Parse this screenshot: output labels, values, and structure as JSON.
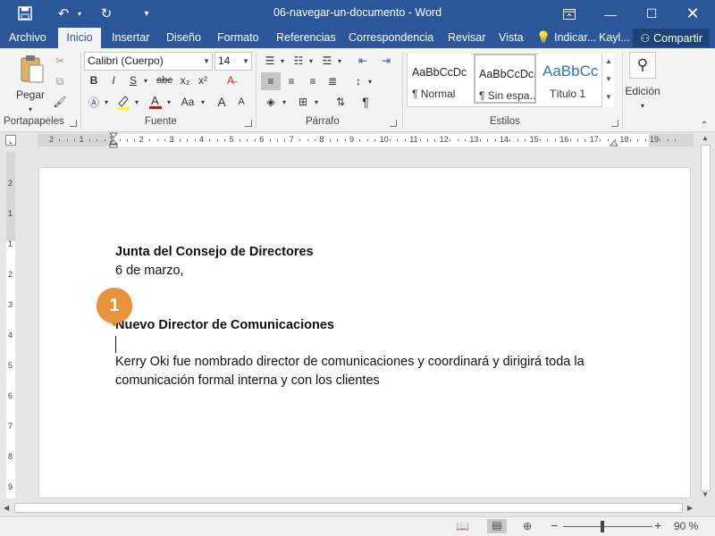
{
  "window": {
    "title": "06-navegar-un-documento  -  Word"
  },
  "quick_access": {
    "icons": [
      "save-icon",
      "undo-icon",
      "redo-icon",
      "customize-icon"
    ]
  },
  "menu": {
    "tabs": [
      {
        "label": "Archivo",
        "active": false
      },
      {
        "label": "Inicio",
        "active": true
      },
      {
        "label": "Insertar",
        "active": false
      },
      {
        "label": "Diseño",
        "active": false
      },
      {
        "label": "Formato",
        "active": false
      },
      {
        "label": "Referencias",
        "active": false
      },
      {
        "label": "Correspondencia",
        "active": false
      },
      {
        "label": "Revisar",
        "active": false
      },
      {
        "label": "Vista",
        "active": false
      }
    ],
    "tell_me": "Indicar...",
    "user": "Kayl...",
    "share_label": "Compartir"
  },
  "ribbon": {
    "clipboard": {
      "paste_label": "Pegar",
      "group_label": "Portapapeles"
    },
    "font": {
      "font_name": "Calibri (Cuerpo)",
      "font_size": "14",
      "group_label": "Fuente",
      "bold": "B",
      "italic": "I",
      "underline": "S",
      "strike": "abc",
      "sub": "x₂",
      "sup": "x²",
      "grow": "A",
      "shrink": "A",
      "case": "Aa"
    },
    "paragraph": {
      "group_label": "Párrafo",
      "pilcrow": "¶"
    },
    "styles": {
      "group_label": "Estilos",
      "tiles": [
        {
          "sample": "AaBbCcDc",
          "name": "¶ Normal"
        },
        {
          "sample": "AaBbCcDc",
          "name": "¶ Sin espa..."
        },
        {
          "sample": "AaBbCc",
          "name": "Título 1"
        }
      ]
    },
    "editing": {
      "label": "Edición"
    }
  },
  "ruler": {
    "numbers": [
      "2",
      "1",
      "1",
      "2",
      "3",
      "4",
      "5",
      "6",
      "7",
      "8",
      "9",
      "10",
      "11",
      "12",
      "13",
      "14",
      "15",
      "16",
      "17",
      "18",
      "19"
    ]
  },
  "vruler": {
    "numbers": [
      "2",
      "1",
      "1",
      "2",
      "3",
      "4",
      "5",
      "6",
      "7",
      "8",
      "9"
    ]
  },
  "document": {
    "heading1": "Junta del Consejo de Directores",
    "date": "6 de marzo,",
    "heading2": "Nuevo Director de Comunicaciones",
    "para_line1": "Kerry Oki fue nombrado director de comunicaciones y coordinará y dirigirá toda la",
    "para_line2": "comunicación formal interna y con los clientes"
  },
  "callout": {
    "number": "1"
  },
  "status": {
    "zoom": "90 %",
    "zoom_minus": "−",
    "zoom_plus": "+"
  },
  "colors": {
    "brand": "#2b579a",
    "callout": "#e8923a",
    "highlight": "#ffff00",
    "font_color": "#ff0000"
  }
}
